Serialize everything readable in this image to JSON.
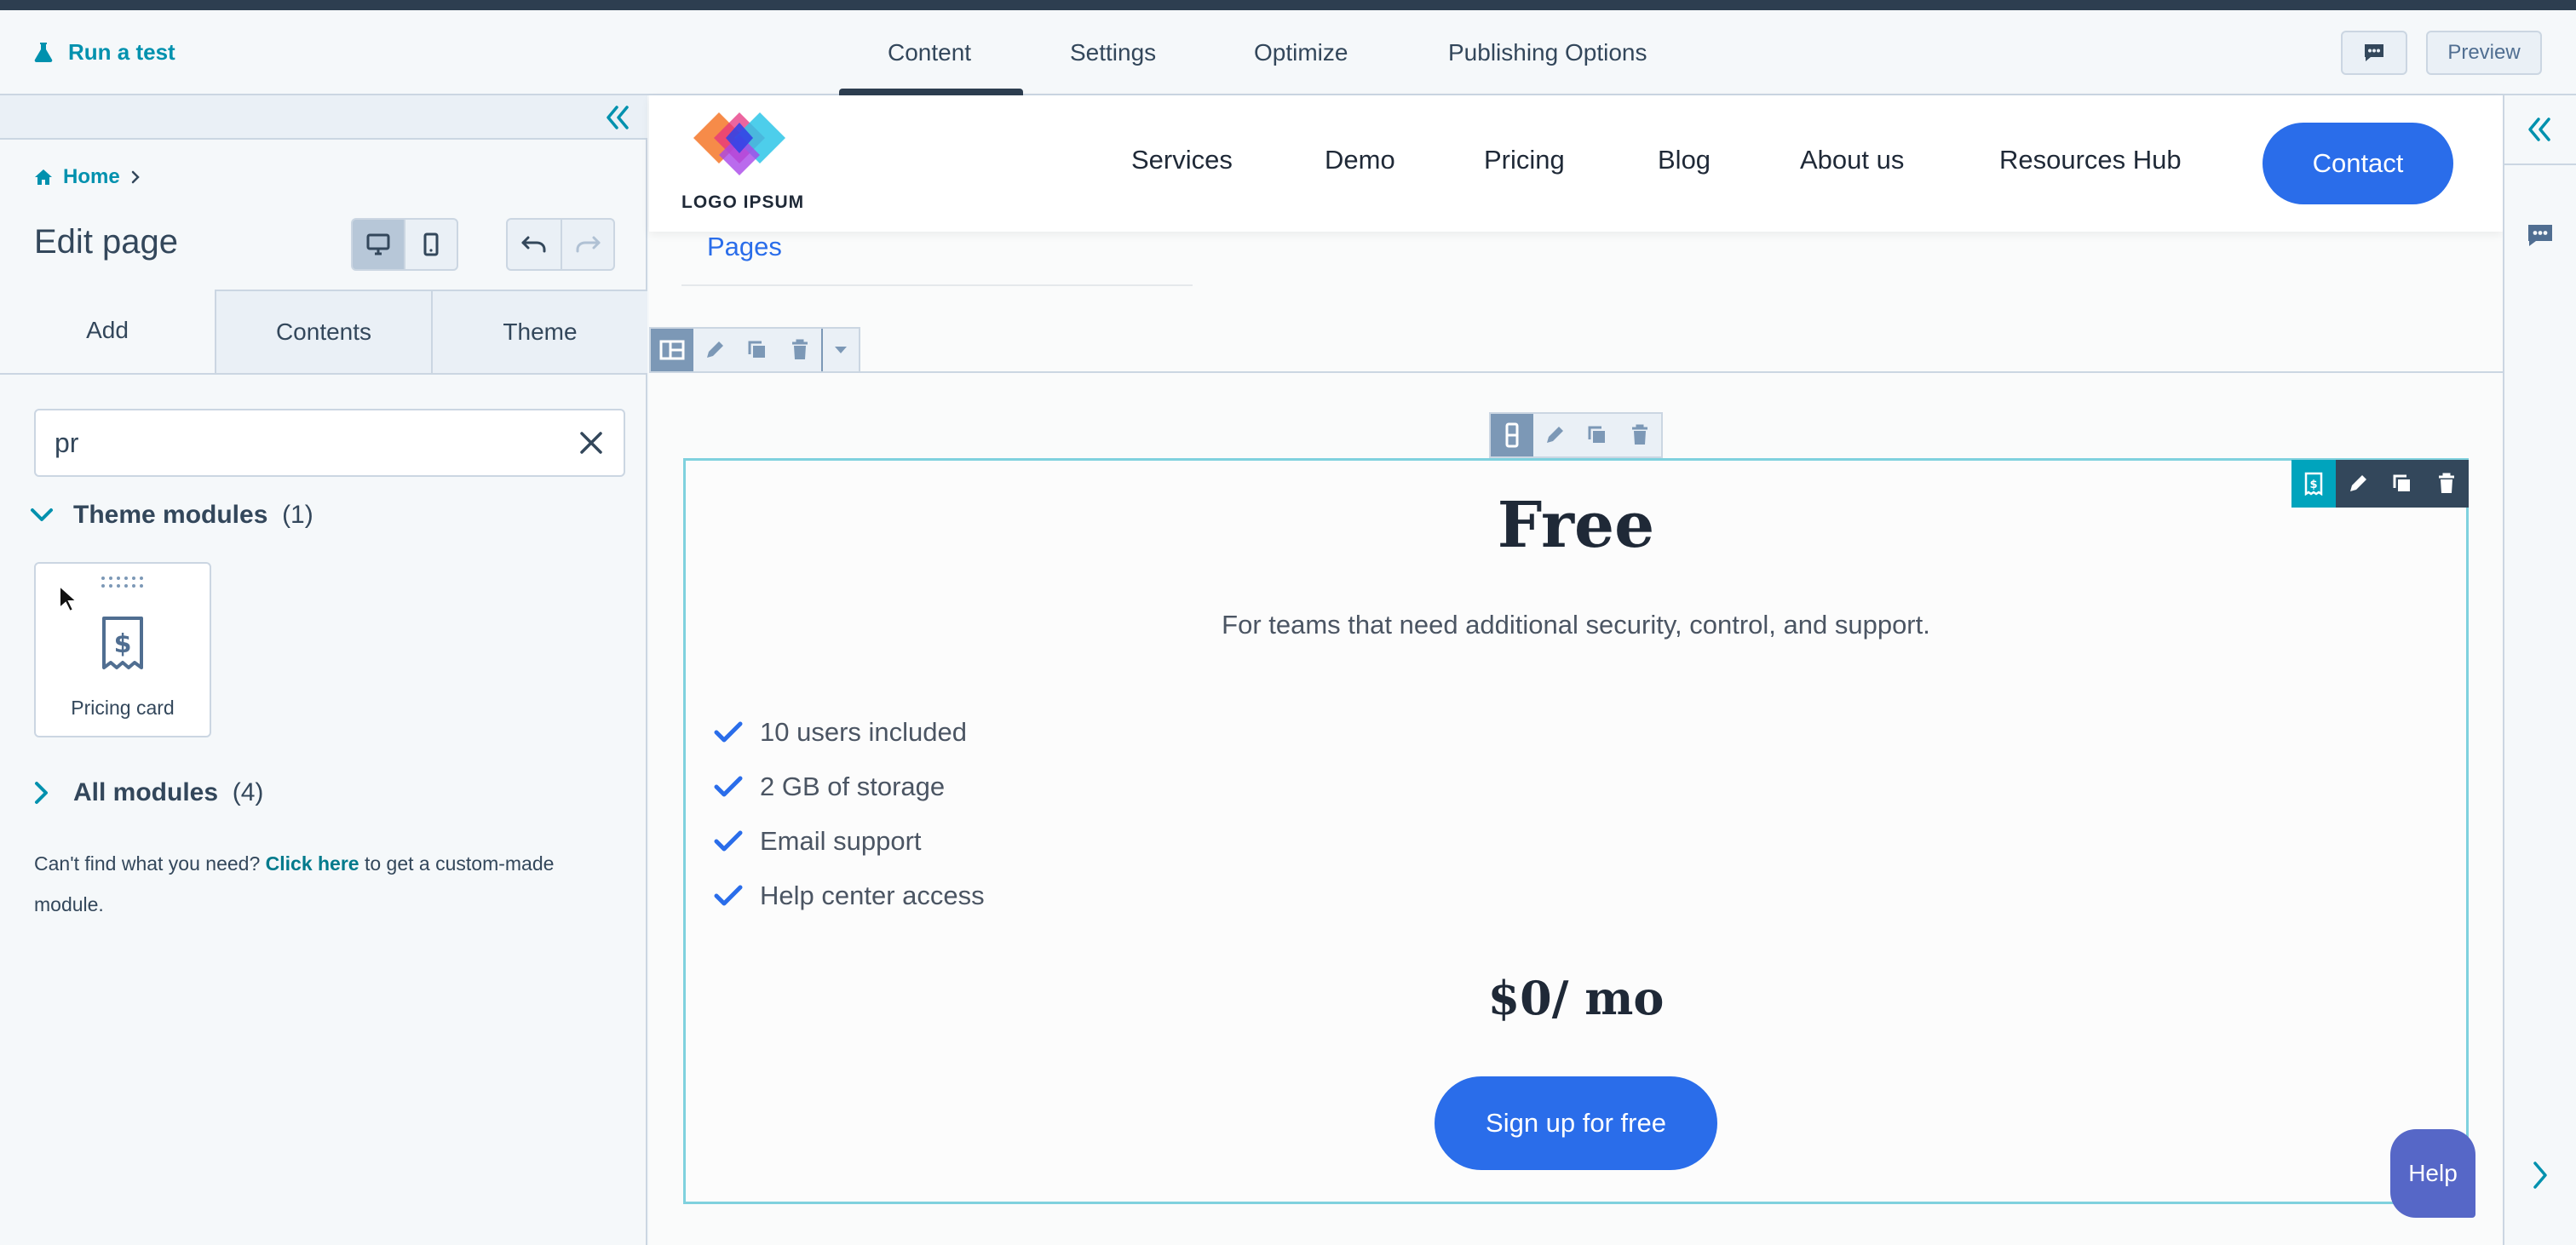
{
  "header": {
    "run_test": "Run a test",
    "tabs": [
      {
        "label": "Content",
        "active": true
      },
      {
        "label": "Settings",
        "active": false
      },
      {
        "label": "Optimize",
        "active": false
      },
      {
        "label": "Publishing Options",
        "active": false
      }
    ],
    "preview": "Preview"
  },
  "left": {
    "breadcrumb": "Home",
    "title": "Edit page",
    "tabs": [
      "Add",
      "Contents",
      "Theme"
    ],
    "search_value": "pr",
    "theme_modules": {
      "label": "Theme modules",
      "count": "(1)"
    },
    "module_card_label": "Pricing card",
    "all_modules": {
      "label": "All modules",
      "count": "(4)"
    },
    "help": {
      "before": "Can't find what you need?",
      "link": "Click here",
      "after": "to get a custom-made module."
    }
  },
  "site": {
    "logo_text": "LOGO IPSUM",
    "nav": [
      "Services",
      "Demo",
      "Pricing",
      "Blog",
      "About us",
      "Resources Hub"
    ],
    "contact": "Contact",
    "pages_link": "Pages"
  },
  "card": {
    "plan": "Free",
    "description": "For teams that need additional security, control, and support.",
    "features": [
      "10 users included",
      "2 GB of storage",
      "Email support",
      "Help center access"
    ],
    "price": "$0/ mo",
    "cta": "Sign up for free"
  },
  "help_bubble": "Help",
  "colors": {
    "accent": "#0091ae",
    "brand_blue": "#2a6dea",
    "card_border": "#7fd1de"
  },
  "icons": [
    "flask-icon",
    "chat-icon",
    "home-icon",
    "chevron-right-icon",
    "double-chevron-left-icon",
    "desktop-icon",
    "mobile-icon",
    "undo-icon",
    "redo-icon",
    "close-icon",
    "chevron-down-icon",
    "receipt-dollar-icon",
    "layout-icon",
    "pencil-icon",
    "copy-icon",
    "trash-icon",
    "check-icon",
    "cursor-icon"
  ]
}
